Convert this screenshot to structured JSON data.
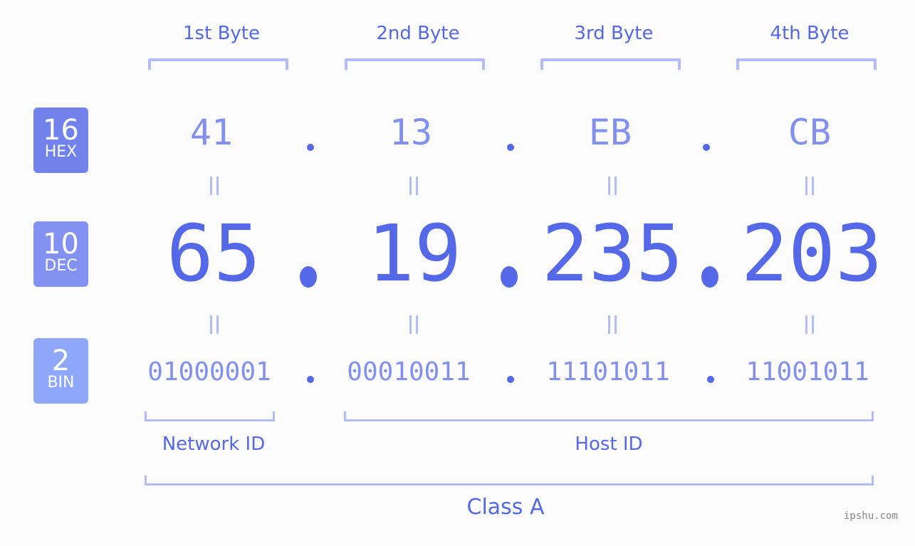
{
  "ip": {
    "decimal": "65.19.235.203",
    "hex": "41.13.EB.CB",
    "binary": "01000001.00010011.11101011.11001011",
    "class": "Class A"
  },
  "badges": [
    {
      "number": "16",
      "label": "HEX",
      "color": "#7282ec"
    },
    {
      "number": "10",
      "label": "DEC",
      "color": "#8392f2"
    },
    {
      "number": "2",
      "label": "BIN",
      "color": "#8fa7f9"
    }
  ],
  "bytes": [
    {
      "label": "1st Byte",
      "hex": "41",
      "dec": "65",
      "bin": "01000001"
    },
    {
      "label": "2nd Byte",
      "hex": "13",
      "dec": "19",
      "bin": "00010011"
    },
    {
      "label": "3rd Byte",
      "hex": "EB",
      "dec": "235",
      "bin": "11101011"
    },
    {
      "label": "4th Byte",
      "hex": "CB",
      "dec": "203",
      "bin": "11001011"
    }
  ],
  "equals_symbol": "=",
  "network_id_label": "Network ID",
  "host_id_label": "Host ID",
  "class_label": "Class A",
  "watermark": "ipshu.com",
  "colors": {
    "accent": "#5468e8",
    "light_accent": "#8290ee",
    "bracket": "#b2bcf7",
    "background": "#fbfcfb"
  }
}
